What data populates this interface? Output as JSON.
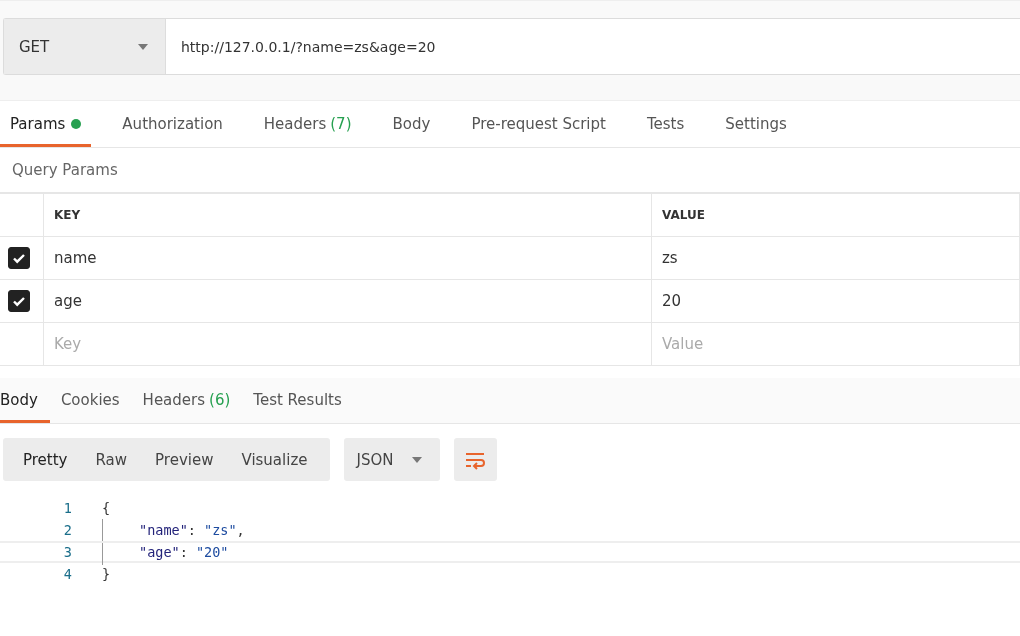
{
  "request": {
    "method": "GET",
    "url": "http://127.0.0.1/?name=zs&age=20"
  },
  "request_tabs": [
    {
      "label": "Params",
      "dot": true,
      "selected": true
    },
    {
      "label": "Authorization",
      "dot": false,
      "selected": false
    },
    {
      "label": "Headers",
      "count": "(7)",
      "dot": false,
      "selected": false
    },
    {
      "label": "Body",
      "dot": false,
      "selected": false
    },
    {
      "label": "Pre-request Script",
      "dot": false,
      "selected": false
    },
    {
      "label": "Tests",
      "dot": false,
      "selected": false
    },
    {
      "label": "Settings",
      "dot": false,
      "selected": false
    }
  ],
  "params_title": "Query Params",
  "params_table": {
    "columns": [
      "KEY",
      "VALUE"
    ],
    "rows": [
      {
        "checked": true,
        "key": "name",
        "value": "zs"
      },
      {
        "checked": true,
        "key": "age",
        "value": "20"
      }
    ],
    "new_row": {
      "key_placeholder": "Key",
      "value_placeholder": "Value"
    }
  },
  "response_tabs": [
    {
      "label": "Body",
      "selected": true
    },
    {
      "label": "Cookies",
      "selected": false
    },
    {
      "label": "Headers",
      "count": "(6)",
      "selected": false
    },
    {
      "label": "Test Results",
      "selected": false
    }
  ],
  "view_modes": [
    {
      "label": "Pretty",
      "selected": true
    },
    {
      "label": "Raw",
      "selected": false
    },
    {
      "label": "Preview",
      "selected": false
    },
    {
      "label": "Visualize",
      "selected": false
    }
  ],
  "format": "JSON",
  "code_lines": [
    {
      "number": "1",
      "active": false,
      "indent": false,
      "tokens": [
        {
          "kind": "punct",
          "text": "{"
        }
      ]
    },
    {
      "number": "2",
      "active": false,
      "indent": true,
      "tokens": [
        {
          "kind": "key",
          "text": "\"name\""
        },
        {
          "kind": "punct",
          "text": ": "
        },
        {
          "kind": "string",
          "text": "\"zs\""
        },
        {
          "kind": "punct",
          "text": ","
        }
      ]
    },
    {
      "number": "3",
      "active": true,
      "indent": true,
      "tokens": [
        {
          "kind": "key",
          "text": "\"age\""
        },
        {
          "kind": "punct",
          "text": ": "
        },
        {
          "kind": "string",
          "text": "\"20\""
        }
      ]
    },
    {
      "number": "4",
      "active": false,
      "indent": false,
      "tokens": [
        {
          "kind": "punct",
          "text": "}"
        }
      ]
    }
  ]
}
